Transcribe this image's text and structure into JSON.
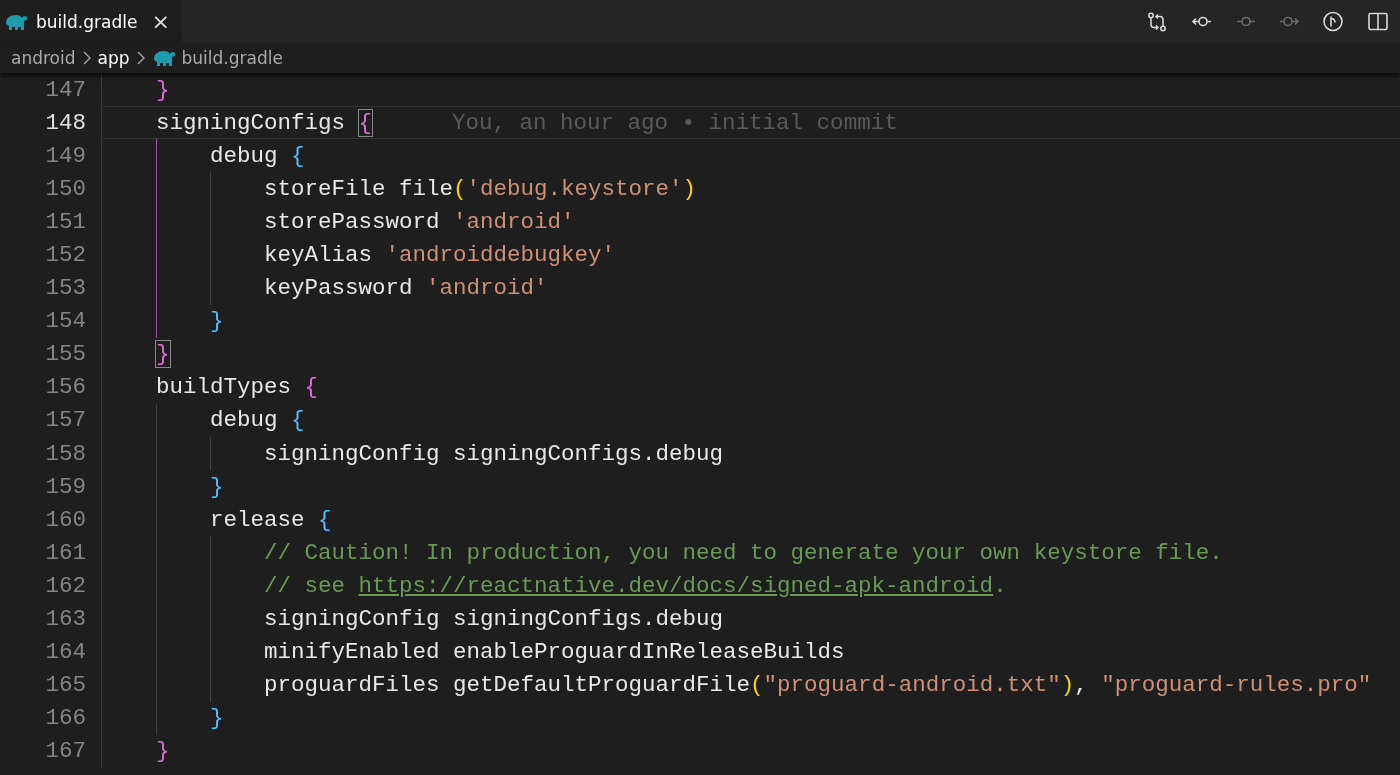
{
  "tabs": [
    {
      "label": "build.gradle",
      "selected": true,
      "close": "×"
    }
  ],
  "toolbar": [
    {
      "kind": "compare",
      "disabled": false
    },
    {
      "kind": "previous",
      "disabled": false
    },
    {
      "kind": "commit",
      "disabled": true
    },
    {
      "kind": "next",
      "disabled": true
    },
    {
      "kind": "branch",
      "disabled": false
    },
    {
      "kind": "split",
      "disabled": false
    }
  ],
  "breadcrumbs": [
    {
      "label": "android",
      "selected": false,
      "file": false
    },
    {
      "label": "app",
      "selected": true,
      "file": false
    },
    {
      "label": "build.gradle",
      "selected": false,
      "file": true
    }
  ],
  "lines": [
    {
      "number": "147",
      "current": false,
      "tokens": [
        {
          "kind": "bracket1",
          "text": "}",
          "matched": false
        }
      ]
    },
    {
      "number": "148",
      "current": true,
      "blame": "You, an hour ago • initial commit",
      "tokens": [
        {
          "kind": "plain",
          "text": "signingConfigs "
        },
        {
          "kind": "bracket1",
          "text": "{",
          "matched": true
        }
      ],
      "children": [
        {
          "number": "149",
          "current": false,
          "tokens": [
            {
              "kind": "plain",
              "text": "debug "
            },
            {
              "kind": "bracket2",
              "text": "{",
              "matched": false
            }
          ],
          "children": [
            {
              "number": "150",
              "current": false,
              "tokens": [
                {
                  "kind": "plain",
                  "text": "storeFile file"
                },
                {
                  "kind": "bracket3",
                  "text": "(",
                  "matched": false
                },
                {
                  "kind": "string",
                  "text": "'debug.keystore'"
                },
                {
                  "kind": "bracket3",
                  "text": ")",
                  "matched": false
                }
              ]
            },
            {
              "number": "151",
              "current": false,
              "tokens": [
                {
                  "kind": "plain",
                  "text": "storePassword "
                },
                {
                  "kind": "string",
                  "text": "'android'"
                }
              ]
            },
            {
              "number": "152",
              "current": false,
              "tokens": [
                {
                  "kind": "plain",
                  "text": "keyAlias "
                },
                {
                  "kind": "string",
                  "text": "'androiddebugkey'"
                }
              ]
            },
            {
              "number": "153",
              "current": false,
              "tokens": [
                {
                  "kind": "plain",
                  "text": "keyPassword "
                },
                {
                  "kind": "string",
                  "text": "'android'"
                }
              ]
            }
          ]
        },
        {
          "number": "154",
          "current": false,
          "tokens": [
            {
              "kind": "bracket2",
              "text": "}",
              "matched": false
            }
          ]
        }
      ]
    },
    {
      "number": "155",
      "current": false,
      "tokens": [
        {
          "kind": "bracket1",
          "text": "}",
          "matched": true
        }
      ]
    },
    {
      "number": "156",
      "current": false,
      "tokens": [
        {
          "kind": "plain",
          "text": "buildTypes "
        },
        {
          "kind": "bracket1",
          "text": "{",
          "matched": false
        }
      ],
      "children": [
        {
          "number": "157",
          "current": false,
          "tokens": [
            {
              "kind": "plain",
              "text": "debug "
            },
            {
              "kind": "bracket2",
              "text": "{",
              "matched": false
            }
          ],
          "children": [
            {
              "number": "158",
              "current": false,
              "tokens": [
                {
                  "kind": "plain",
                  "text": "signingConfig signingConfigs.debug"
                }
              ]
            }
          ]
        },
        {
          "number": "159",
          "current": false,
          "tokens": [
            {
              "kind": "bracket2",
              "text": "}",
              "matched": false
            }
          ]
        },
        {
          "number": "160",
          "current": false,
          "tokens": [
            {
              "kind": "plain",
              "text": "release "
            },
            {
              "kind": "bracket2",
              "text": "{",
              "matched": false
            }
          ],
          "children": [
            {
              "number": "161",
              "current": false,
              "tokens": [
                {
                  "kind": "comment",
                  "text": "// Caution! In production, you need to generate your own keystore file."
                }
              ]
            },
            {
              "number": "162",
              "current": false,
              "tokens": [
                {
                  "kind": "comment",
                  "text": "// see "
                },
                {
                  "kind": "link",
                  "text": "https://reactnative.dev/docs/signed-apk-android"
                },
                {
                  "kind": "comment",
                  "text": "."
                }
              ]
            },
            {
              "number": "163",
              "current": false,
              "tokens": [
                {
                  "kind": "plain",
                  "text": "signingConfig signingConfigs.debug"
                }
              ]
            },
            {
              "number": "164",
              "current": false,
              "tokens": [
                {
                  "kind": "plain",
                  "text": "minifyEnabled enableProguardInReleaseBuilds"
                }
              ]
            },
            {
              "number": "165",
              "current": false,
              "tokens": [
                {
                  "kind": "plain",
                  "text": "proguardFiles getDefaultProguardFile"
                },
                {
                  "kind": "bracket3",
                  "text": "(",
                  "matched": false
                },
                {
                  "kind": "string",
                  "text": "\"proguard-android.txt\""
                },
                {
                  "kind": "bracket3",
                  "text": ")",
                  "matched": false
                },
                {
                  "kind": "plain",
                  "text": ", "
                },
                {
                  "kind": "string",
                  "text": "\"proguard-rules.pro\""
                }
              ]
            }
          ]
        },
        {
          "number": "166",
          "current": false,
          "tokens": [
            {
              "kind": "bracket2",
              "text": "}",
              "matched": false
            }
          ]
        }
      ]
    },
    {
      "number": "167",
      "current": false,
      "tokens": [
        {
          "kind": "bracket1",
          "text": "}",
          "matched": false
        }
      ]
    }
  ]
}
